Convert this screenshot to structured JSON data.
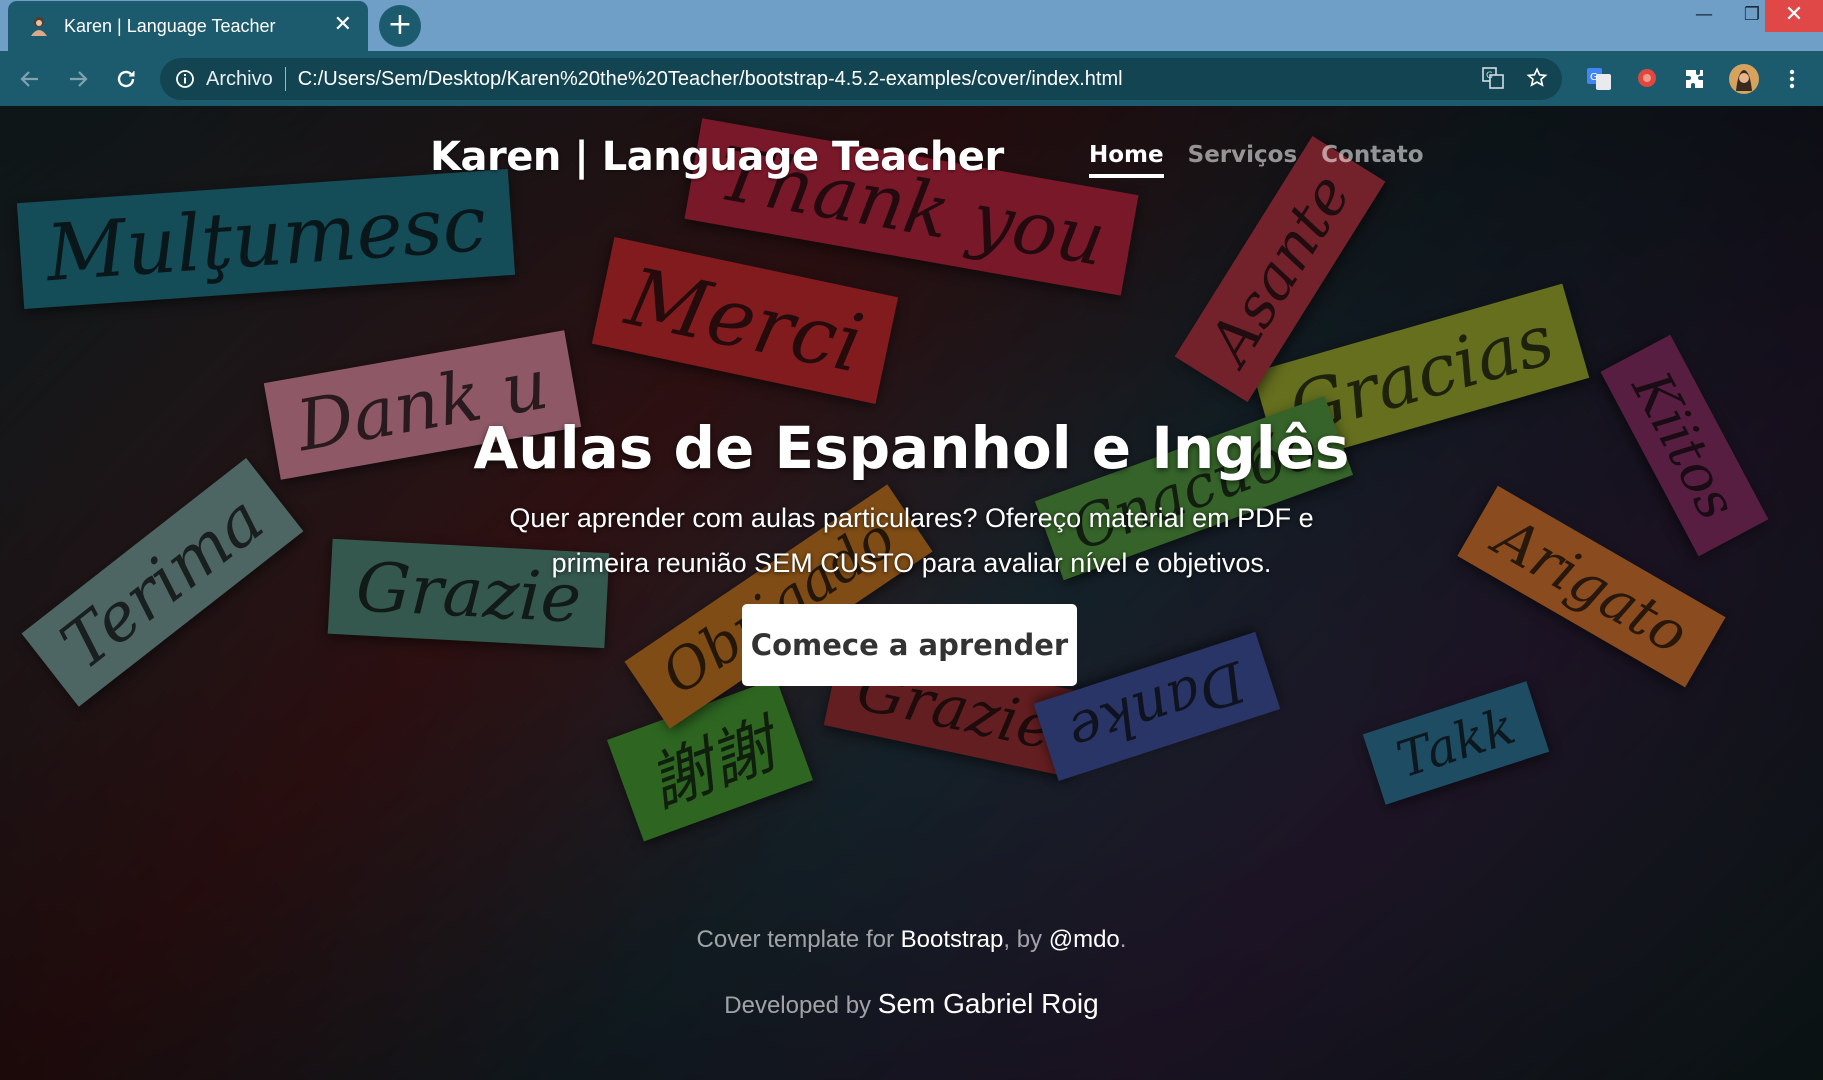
{
  "browser": {
    "tab_title": "Karen | Language Teacher",
    "tab_close": "✕",
    "new_tab": "+",
    "omnibox_label": "Archivo",
    "url": "C:/Users/Sem/Desktop/Karen%20the%20Teacher/bootstrap-4.5.2-examples/cover/index.html",
    "window_min": "—",
    "window_max": "❐",
    "window_close": "✕"
  },
  "background_words": [
    {
      "text": "Mulţumesc",
      "bg": "#1d6a7a"
    },
    {
      "text": "Thank you",
      "bg": "#a8223a"
    },
    {
      "text": "Merci",
      "bg": "#b3262a"
    },
    {
      "text": "Gracias",
      "bg": "#8c9a2a"
    },
    {
      "text": "Dank u",
      "bg": "#c77a8e"
    },
    {
      "text": "Grazie",
      "bg": "#4a7a6c"
    },
    {
      "text": "Terima",
      "bg": "#6c8e8a"
    },
    {
      "text": "Asante",
      "bg": "#a0303e"
    },
    {
      "text": "謝謝",
      "bg": "#3f8d2e"
    },
    {
      "text": "Obrigado",
      "bg": "#b06a1e"
    },
    {
      "text": "Grazie",
      "bg": "#8a2a2e"
    },
    {
      "text": "Cпасибо",
      "bg": "#4a8a3a"
    },
    {
      "text": "Danke",
      "bg": "#3a4a8e"
    },
    {
      "text": "Arigato",
      "bg": "#c06a2a"
    },
    {
      "text": "Takk",
      "bg": "#2a6a8a"
    },
    {
      "text": "Kiitos",
      "bg": "#7a2a5a"
    }
  ],
  "header": {
    "brand": "Karen | Language Teacher",
    "nav": [
      "Home",
      "Serviços",
      "Contato"
    ]
  },
  "hero": {
    "title": "Aulas de Espanhol e Inglês",
    "lead_line1": "Quer aprender com aulas particulares? Ofereço material em PDF e",
    "lead_line2": "primeira reunião SEM CUSTO para avaliar nível e objetivos.",
    "cta": "Comece a aprender"
  },
  "footer": {
    "line1_prefix": "Cover template for ",
    "line1_link1": "Bootstrap",
    "line1_mid": ", by ",
    "line1_link2": "@mdo",
    "line1_suffix": ".",
    "line2_prefix": "Developed by ",
    "line2_name": "Sem Gabriel Roig"
  },
  "colors": {
    "tabstrip": "#6f9ec6",
    "toolbar": "#1c5b6e",
    "close_red": "#e04848"
  }
}
